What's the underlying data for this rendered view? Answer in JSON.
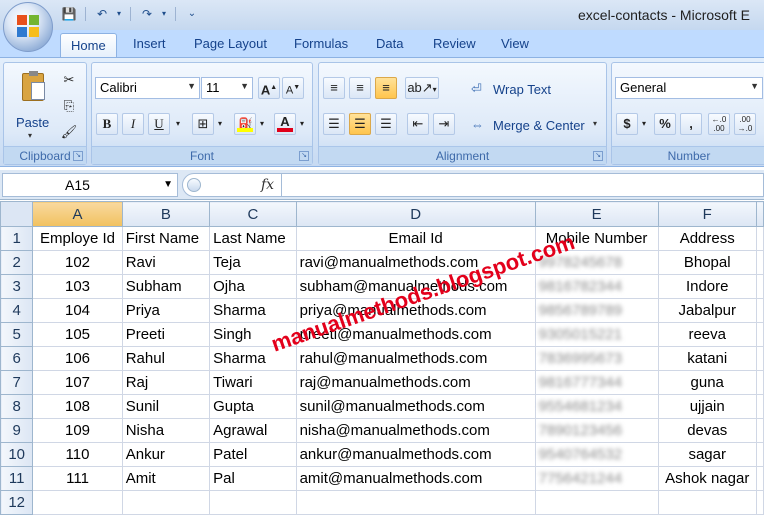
{
  "window": {
    "title": "excel-contacts - Microsoft E"
  },
  "tabs": [
    "Home",
    "Insert",
    "Page Layout",
    "Formulas",
    "Data",
    "Review",
    "View"
  ],
  "ribbon": {
    "clipboard": {
      "label": "Clipboard",
      "paste": "Paste"
    },
    "font": {
      "label": "Font",
      "name": "Calibri",
      "size": "11",
      "bold": "B",
      "italic": "I",
      "underline": "U"
    },
    "alignment": {
      "label": "Alignment",
      "wrap_text": "Wrap Text",
      "merge_center": "Merge & Center"
    },
    "number": {
      "label": "Number",
      "format": "General",
      "currency": "$",
      "percent": "%",
      "comma": ",",
      "inc_decimal": "←.0 .00",
      "dec_decimal": ".00 →.0"
    }
  },
  "formula_bar": {
    "name_box": "A15",
    "fx": "fx",
    "formula": ""
  },
  "sheet": {
    "columns": [
      "A",
      "B",
      "C",
      "D",
      "E",
      "F"
    ],
    "row_numbers": [
      "1",
      "2",
      "3",
      "4",
      "5",
      "6",
      "7",
      "8",
      "9",
      "10",
      "11",
      "12"
    ],
    "headers": [
      "Employe Id",
      "First Name",
      "Last Name",
      "Email Id",
      "Mobile Number",
      "Address"
    ],
    "rows": [
      [
        "102",
        "Ravi",
        "Teja",
        "ravi@manualmethods.com",
        "9978245678",
        "Bhopal"
      ],
      [
        "103",
        "Subham",
        "Ojha",
        "subham@manualmethods.com",
        "9816782344",
        "Indore"
      ],
      [
        "104",
        "Priya",
        "Sharma",
        "priya@manualmethods.com",
        "9856789789",
        "Jabalpur"
      ],
      [
        "105",
        "Preeti",
        "Singh",
        "preeti@manualmethods.com",
        "9305015221",
        "reeva"
      ],
      [
        "106",
        "Rahul",
        "Sharma",
        "rahul@manualmethods.com",
        "7836995673",
        "katani"
      ],
      [
        "107",
        "Raj",
        "Tiwari",
        "raj@manualmethods.com",
        "9816777344",
        "guna"
      ],
      [
        "108",
        "Sunil",
        "Gupta",
        "sunil@manualmethods.com",
        "9554681234",
        "ujjain"
      ],
      [
        "109",
        "Nisha",
        "Agrawal",
        "nisha@manualmethods.com",
        "7890123456",
        "devas"
      ],
      [
        "110",
        "Ankur",
        "Patel",
        "ankur@manualmethods.com",
        "9540764532",
        "sagar"
      ],
      [
        "111",
        "Amit",
        "Pal",
        "amit@manualmethods.com",
        "7756421244",
        "Ashok nagar"
      ]
    ]
  },
  "watermark": "manualmethods.blogspot.com",
  "colors": {
    "accent": "#15428b",
    "watermark": "#e3001b",
    "selected_header": "#f1c15f"
  }
}
